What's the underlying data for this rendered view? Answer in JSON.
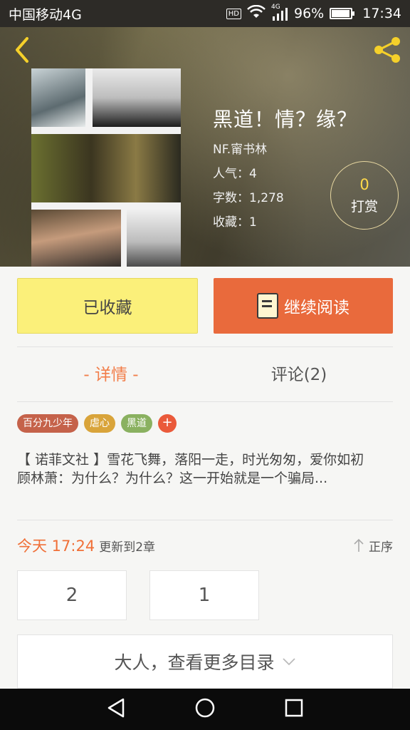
{
  "status_bar": {
    "carrier": "中国移动4G",
    "hd": "HD",
    "network": "4G",
    "battery": "96%",
    "battery_level": 0.96,
    "time": "17:34"
  },
  "book": {
    "title": "黑道！情？缘？",
    "author": "NF.甯书林",
    "popularity": "人气：4",
    "word_count": "字数：1,278",
    "favorites": "收藏：1"
  },
  "tip": {
    "count": "0",
    "label": "打赏"
  },
  "actions": {
    "favorited_label": "已收藏",
    "read_label": "继续阅读"
  },
  "tabs": [
    {
      "label": "- 详情 -",
      "active": true
    },
    {
      "label": "评论(2)",
      "active": false
    }
  ],
  "tags": [
    "百分九少年",
    "虐心",
    "黑道"
  ],
  "tag_add": "+",
  "description": {
    "line1": "【 诺菲文社 】雪花飞舞，落阳一走，时光匆匆，爱你如初",
    "line2": "顾林萧：为什么？为什么？这一开始就是一个骗局..."
  },
  "update": {
    "time": "今天 17:24",
    "text": "更新到2章",
    "sort_label": "正序"
  },
  "chapters": [
    "2",
    "1"
  ],
  "more_catalog": "大人，查看更多目录",
  "colors": {
    "accent": "#e96a3c",
    "fav_bg": "#fbf07a",
    "tab_active": "#f27e4a"
  }
}
